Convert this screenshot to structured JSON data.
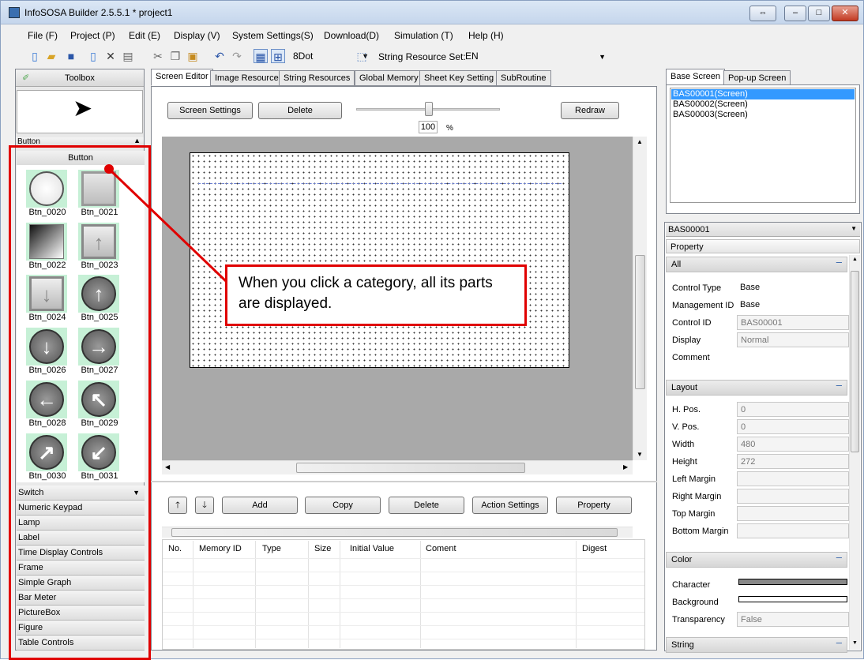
{
  "window": {
    "title": "InfoSOSA Builder 2.5.5.1 * project1",
    "controls": [
      "⇔",
      "–",
      "□",
      "✕"
    ]
  },
  "menu": [
    "File (F)",
    "Project (P)",
    "Edit (E)",
    "Display (V)",
    "System Settings(S)",
    "Download(D)",
    "Simulation (T)",
    "Help (H)"
  ],
  "toolbar": {
    "grid_value": "8Dot",
    "string_resource_label": "String Resource Set:",
    "string_resource_value": "EN"
  },
  "toolbox": {
    "title": "Toolbox",
    "section_header": "Button",
    "group_label": "Button",
    "parts": [
      "Btn_0020",
      "Btn_0021",
      "Btn_0022",
      "Btn_0023",
      "Btn_0024",
      "Btn_0025",
      "Btn_0026",
      "Btn_0027",
      "Btn_0028",
      "Btn_0029",
      "Btn_0030",
      "Btn_0031"
    ],
    "categories": [
      "Switch",
      "Numeric Keypad",
      "Lamp",
      "Label",
      "Time Display Controls",
      "Frame",
      "Simple Graph",
      "Bar Meter",
      "PictureBox",
      "Figure",
      "Table Controls"
    ]
  },
  "editor": {
    "tabs": [
      "Screen Editor",
      "Image Resource",
      "String Resources",
      "Global Memory",
      "Sheet Key Setting",
      "SubRoutine"
    ],
    "screen_settings": "Screen Settings",
    "delete": "Delete",
    "zoom_value": "100",
    "zoom_unit": "%",
    "zoom_fraction": 0.5,
    "redraw": "Redraw"
  },
  "actions": {
    "add": "Add",
    "copy": "Copy",
    "delete": "Delete",
    "action_settings": "Action Settings",
    "property": "Property"
  },
  "memory_table": {
    "columns": [
      "No.",
      "Memory ID",
      "Type",
      "Size",
      "Initial Value",
      "Coment",
      "Digest"
    ]
  },
  "screens": {
    "tabs": [
      "Base Screen",
      "Pop-up Screen"
    ],
    "items": [
      "BAS00001(Screen)",
      "BAS00002(Screen)",
      "BAS00003(Screen)"
    ]
  },
  "property": {
    "selector": "BAS00001",
    "header": "Property",
    "groups": {
      "all": "All",
      "layout": "Layout",
      "color": "Color",
      "string": "String"
    },
    "all": [
      [
        "Control Type",
        "Base"
      ],
      [
        "Management ID",
        "Base"
      ],
      [
        "Control ID",
        "BAS00001"
      ],
      [
        "Display",
        "Normal"
      ],
      [
        "Comment",
        ""
      ]
    ],
    "layout": [
      [
        "H. Pos.",
        "0"
      ],
      [
        "V. Pos.",
        "0"
      ],
      [
        "Width",
        "480"
      ],
      [
        "Height",
        "272"
      ],
      [
        "Left Margin",
        ""
      ],
      [
        "Right Margin",
        ""
      ],
      [
        "Top Margin",
        ""
      ],
      [
        "Bottom Margin",
        ""
      ]
    ],
    "color": [
      [
        "Character",
        ""
      ],
      [
        "Background",
        ""
      ],
      [
        "Transparency",
        "False"
      ]
    ]
  },
  "callout": "When you click a category, all its parts are displayed.",
  "colors": {
    "accent_red": "#e00000",
    "selection_blue": "#3399ff",
    "part_bg": "#c6f0d6"
  }
}
